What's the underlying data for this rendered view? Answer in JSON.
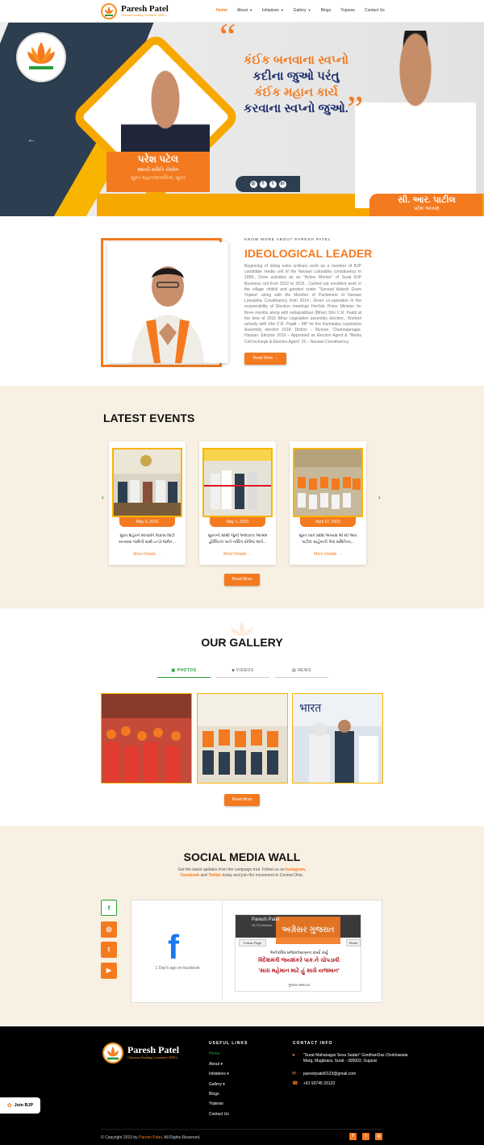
{
  "header": {
    "logo_name": "Paresh Patel",
    "logo_tagline": "Chairman Standing Committee (SMC)",
    "nav": [
      {
        "label": "Home",
        "active": true,
        "dropdown": false
      },
      {
        "label": "About",
        "active": false,
        "dropdown": true
      },
      {
        "label": "Initiatives",
        "active": false,
        "dropdown": true
      },
      {
        "label": "Gallery",
        "active": false,
        "dropdown": true
      },
      {
        "label": "Blogs",
        "active": false,
        "dropdown": false
      },
      {
        "label": "Yojanao",
        "active": false,
        "dropdown": false
      },
      {
        "label": "Contact Us",
        "active": false,
        "dropdown": false
      }
    ]
  },
  "hero": {
    "quote_lines": [
      "કંઈક બનવાના સ્વપ્નો",
      "કદીના જુઓ પરંતુ",
      "કંઈક મહાન કાર્ય",
      "કરવાના સ્વપ્નો જુઓ."
    ],
    "quote_open": "“",
    "quote_close": "”",
    "name": "પરેશ પટેલ",
    "role_line1": "સ્થાયી સમિતિ ચેરમેન",
    "role_line2": "સુરત મહાનગરપાલિકા, સુરત",
    "cr_name": "સી. આર. પાટીલ",
    "cr_role": "પ્રદેશ અધ્યક્ષ",
    "prev_arrow": "←",
    "social_icons": [
      "instagram-icon",
      "facebook-icon",
      "twitter-icon",
      "linkedin-icon"
    ],
    "social_glyphs": [
      "◎",
      "f",
      "t",
      "in"
    ]
  },
  "about": {
    "kicker": "KNOW MORE ABOUT PARESH PATEL",
    "title": "IDEOLOGICAL LEADER",
    "text": "Beginning of doing extra ordinary work as a member of BJP candidate media cell of the Navsari Loksabha constituency in 1999., Done activities as an \"Active Worker\" of Surat BJP Business cell from 2012 to 2015., Carried out excellent work in the village chikhli and gandevi under \"Sansad Adarsh Gram Yojana\" along with the Member of Parliament of Navsari Loksabha Constituency from 2014., Given co-operation in the responsibility of Election meetings Hon'ble Prime Minister for three months along with sahaprabhari (Bihar) Shri C.R. Paatil at the time of 2016 Bihar Legislative assembly election., Worked actively with Shri C.R. Paatil – MP for the Karnataka Legislative Assembly election 2018, District – Mysore, Chamrajanagar, Hassan. Election 2019 – Appointed as Election Agent & \"Media Cell Incharge & Election Agent\" 25 – Navsari Constituency.",
    "button": "Read More",
    "button_arrow": "→"
  },
  "events": {
    "title": "LATEST EVENTS",
    "prev": "‹",
    "next": "›",
    "items": [
      {
        "date": "May 4, 2023",
        "text1": "સુરત શહેરને સ્વચ્છતિ વિકાસ સિટી",
        "text2": "બનાવવા જર્મની સાથે ઇન્ડો-જર્મન...",
        "more": "More Details  →"
      },
      {
        "date": "May 1, 2023",
        "text1": "સુરતની સૌથી જુની અલાકતા આશ્રમ",
        "text2": "હોસ્પિટલ ખાતે નર્સિંગ કોલેજ અને...",
        "more": "More Details  →"
      },
      {
        "date": "April 27, 2023",
        "text1": "સુરત ખાતે પ્રદેશ અધ્યક્ષ શ્રી સી આર",
        "text2": "પાટીલ સાહેબની પેજ સમિતિના...",
        "more": "More Details  →"
      }
    ],
    "button": "Read More"
  },
  "gallery": {
    "title": "OUR GALLERY",
    "tabs": [
      {
        "label": "PHOTOS",
        "icon": "image-icon",
        "glyph": "▣",
        "active": true
      },
      {
        "label": "VIDEOS",
        "icon": "video-icon",
        "glyph": "■",
        "active": false
      },
      {
        "label": "NEWS",
        "icon": "news-icon",
        "glyph": "▤",
        "active": false
      }
    ],
    "button": "Read More"
  },
  "social": {
    "title": "SOCIAL MEDIA WALL",
    "desc_pre": "Get the latest updates from the campaign trail. Follow us on ",
    "desc_instagram": "Instagram",
    "desc_sep": ", ",
    "desc_facebook": "Facebook",
    "desc_and": " and ",
    "desc_twitter": "Twitter",
    "desc_post": " today and join the movement in Central Ohio.",
    "buttons": [
      {
        "name": "facebook-icon",
        "glyph": "f"
      },
      {
        "name": "instagram-icon",
        "glyph": "◎"
      },
      {
        "name": "twitter-icon",
        "glyph": "t"
      },
      {
        "name": "youtube-icon",
        "glyph": "▶"
      }
    ],
    "fb_logo": "f",
    "fb_time": "1 Day's ago on facebook",
    "post": {
      "name": "Paresh Patel",
      "likes": "35,733 followers",
      "follow": "Follow Page",
      "share": "Share",
      "banner": "અગ્રેસર ગુજરાત",
      "line1": "અનેકવિધ પ્રજાકલ્યાણના કાર્યો કર્યુ",
      "line2": "વિદેશમંત્રી જયશંકરે પાક.ને ચોપડાવી",
      "line3": "'સારા મહેમાન માટે હું સારો યજમાન'",
      "line4": "ગુજરાત સમાચાર"
    }
  },
  "footer": {
    "logo_name": "Paresh Patel",
    "logo_tagline": "Chairman Standing Committee (SMC)",
    "links_title": "USEFUL LINKS",
    "links": [
      {
        "label": "Home",
        "active": true
      },
      {
        "label": "About ▾",
        "active": false
      },
      {
        "label": "Initiatives ▾",
        "active": false
      },
      {
        "label": "Gallery ▾",
        "active": false
      },
      {
        "label": "Blogs",
        "active": false
      },
      {
        "label": "Yojanao",
        "active": false
      },
      {
        "label": "Contact Us",
        "active": false
      }
    ],
    "contact_title": "CONTACT INFO",
    "address": "\"Surat Mahanagar Seva Sadan\" GordhanDas Chokhawala Marg, Muglisara, Surat - 395003, Gujarat",
    "email": "pareshpatel0123@gmail.com",
    "phone": "+91 93745 33123",
    "copyright_pre": "© Copyright 2023 by ",
    "copyright_name": "Paresh Patel",
    "copyright_post": ". All Rights Reserved.",
    "social_glyphs": [
      "f",
      "t",
      "◎"
    ]
  },
  "join": {
    "label": "Join BJP",
    "icon": "lotus-icon"
  },
  "colors": {
    "accent": "#f47a20",
    "navy": "#2d3e50",
    "green": "#2a9d3a",
    "cream": "#f8f0e2"
  }
}
